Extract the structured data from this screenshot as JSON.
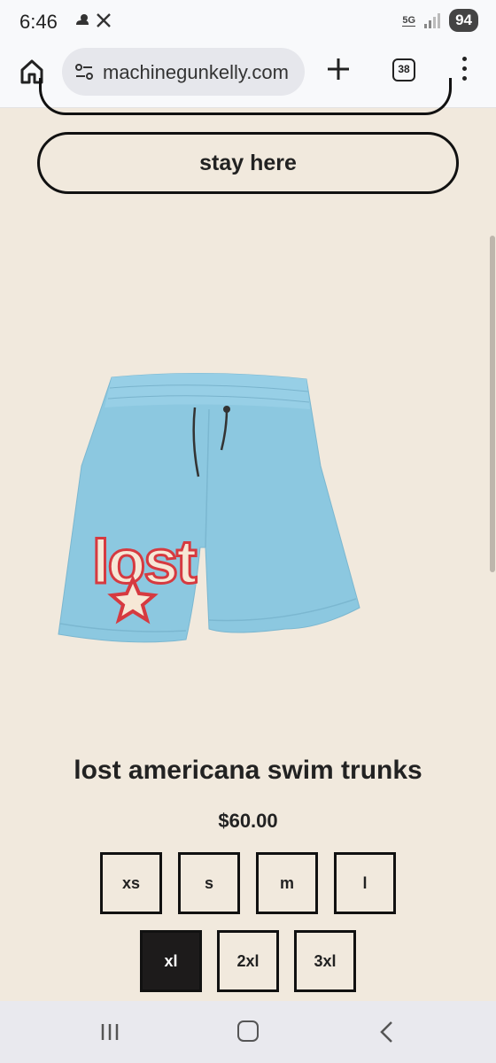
{
  "status_bar": {
    "time": "6:46",
    "network": "5G",
    "battery": "94"
  },
  "browser": {
    "url": "machinegunkelly.com",
    "tab_count": "38"
  },
  "page": {
    "stay_button_label": "stay here",
    "product": {
      "title": "lost americana swim trunks",
      "price": "$60.00",
      "logo_text": "lost",
      "sizes": [
        {
          "label": "xs",
          "selected": false
        },
        {
          "label": "s",
          "selected": false
        },
        {
          "label": "m",
          "selected": false
        },
        {
          "label": "l",
          "selected": false
        },
        {
          "label": "xl",
          "selected": true
        },
        {
          "label": "2xl",
          "selected": false
        },
        {
          "label": "3xl",
          "selected": false
        }
      ]
    }
  },
  "colors": {
    "page_background": "#f1e9dd",
    "shorts": "#8cc8e0",
    "selected_size": "#1d1b1b"
  }
}
